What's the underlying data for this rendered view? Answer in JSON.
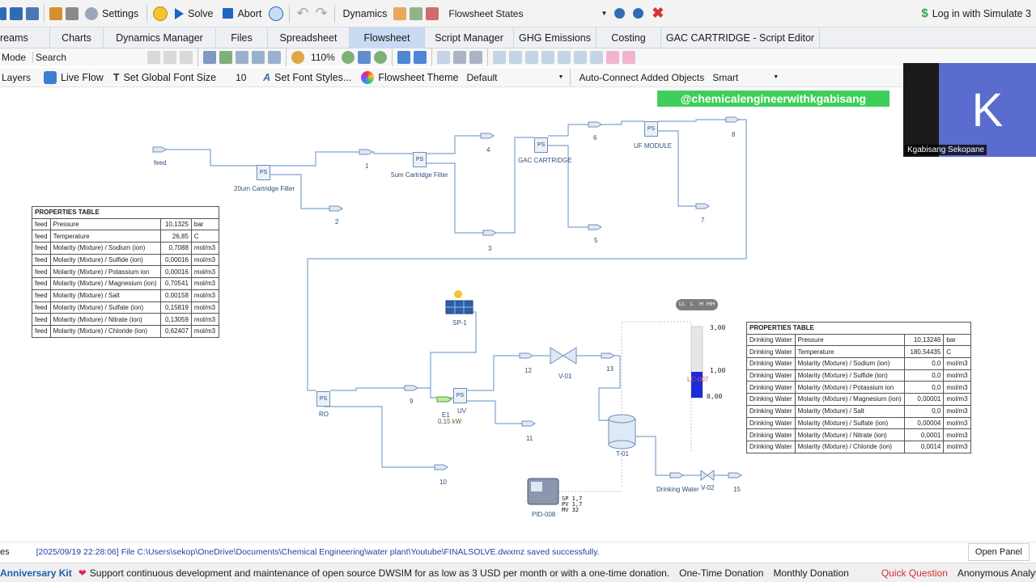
{
  "toolbar": {
    "settings": "Settings",
    "solve": "Solve",
    "abort": "Abort",
    "dynamics": "Dynamics",
    "flowsheet_states": "Flowsheet States",
    "login": "Log in with Simulate 3"
  },
  "tabs": [
    "reams",
    "Charts",
    "Dynamics Manager",
    "Files",
    "Spreadsheet",
    "Flowsheet",
    "Script Manager",
    "GHG Emissions",
    "Costing",
    "GAC CARTRIDGE - Script Editor"
  ],
  "active_tab": "Flowsheet",
  "toolbar2": {
    "mode": "Mode",
    "search": "Search",
    "zoom": "110%"
  },
  "toolbar3": {
    "layers": "Layers",
    "live_flow": "Live Flow",
    "global_font": "Set Global Font Size",
    "font_size": "10",
    "font_styles": "Set Font Styles...",
    "theme_label": "Flowsheet Theme",
    "theme_value": "Default",
    "autoconnect_label": "Auto-Connect Added Objects",
    "autoconnect_value": "Smart"
  },
  "watermark": "@chemicalengineerwithkgabisang",
  "webcam": {
    "initial": "K",
    "name": "Kgabisang Sekopane"
  },
  "flowsheet": {
    "streams": [
      "feed",
      "1",
      "2",
      "3",
      "4",
      "5",
      "6",
      "7",
      "8",
      "9",
      "10",
      "11",
      "12",
      "13",
      "15",
      "Drinking Water"
    ],
    "units": {
      "cf20": "20um Cartridge Filter",
      "cf5": "5um Cartridge Filter",
      "gac": "GAC CARTRIDGE",
      "uf": "UF MODULE",
      "ro": "RO",
      "uv": "UV",
      "sp1": "SP-1",
      "e1": "E1",
      "e1_power": "0,15 kW",
      "v01": "V-01",
      "v02": "V-02",
      "t01": "T-01",
      "lc": "LC-007",
      "pid": "PID-008"
    },
    "ps_label": "PS",
    "level_scale": [
      "3,00",
      "1,00",
      "0,00"
    ],
    "level_buttons": [
      "LL",
      "L",
      "H",
      "HH"
    ],
    "pid_readout": [
      "SP 1,7",
      "PV 1,7",
      "MV 32"
    ]
  },
  "feed_table": {
    "title": "PROPERTIES TABLE",
    "rows": [
      [
        "feed",
        "Pressure",
        "10,1325",
        "bar"
      ],
      [
        "feed",
        "Temperature",
        "26,85",
        "C"
      ],
      [
        "feed",
        "Molarity (Mixture) / Sodium (ion)",
        "0,7088",
        "mol/m3"
      ],
      [
        "feed",
        "Molarity (Mixture) / Sulfide (ion)",
        "0,00016",
        "mol/m3"
      ],
      [
        "feed",
        "Molarity (Mixture) / Potassium ion",
        "0,00016",
        "mol/m3"
      ],
      [
        "feed",
        "Molarity (Mixture) / Magnesium (ion)",
        "0,70541",
        "mol/m3"
      ],
      [
        "feed",
        "Molarity (Mixture) / Salt",
        "0,00158",
        "mol/m3"
      ],
      [
        "feed",
        "Molarity (Mixture) / Sulfate (ion)",
        "0,15819",
        "mol/m3"
      ],
      [
        "feed",
        "Molarity (Mixture) / Nitrate (ion)",
        "0,13059",
        "mol/m3"
      ],
      [
        "feed",
        "Molarity (Mixture) / Chloride (ion)",
        "0,62407",
        "mol/m3"
      ]
    ]
  },
  "dw_table": {
    "title": "PROPERTIES TABLE",
    "rows": [
      [
        "Drinking Water",
        "Pressure",
        "10,13246",
        "bar"
      ],
      [
        "Drinking Water",
        "Temperature",
        "180,54435",
        "C"
      ],
      [
        "Drinking Water",
        "Molarity (Mixture) / Sodium (ion)",
        "0,0",
        "mol/m3"
      ],
      [
        "Drinking Water",
        "Molarity (Mixture) / Sulfide (ion)",
        "0,0",
        "mol/m3"
      ],
      [
        "Drinking Water",
        "Molarity (Mixture) / Potassium ion",
        "0,0",
        "mol/m3"
      ],
      [
        "Drinking Water",
        "Molarity (Mixture) / Magnesium (ion)",
        "0,00001",
        "mol/m3"
      ],
      [
        "Drinking Water",
        "Molarity (Mixture) / Salt",
        "0,0",
        "mol/m3"
      ],
      [
        "Drinking Water",
        "Molarity (Mixture) / Sulfate (ion)",
        "0,00004",
        "mol/m3"
      ],
      [
        "Drinking Water",
        "Molarity (Mixture) / Nitrate (ion)",
        "0,0001",
        "mol/m3"
      ],
      [
        "Drinking Water",
        "Molarity (Mixture) / Chloride (ion)",
        "0,0014",
        "mol/m3"
      ]
    ]
  },
  "log": {
    "prefix": "es",
    "message": "[2025/09/19 22:28:06] File C:\\Users\\sekop\\OneDrive\\Documents\\Chemical Engineering\\water plant\\Youtube\\FINALSOLVE.dwxmz saved successfully.",
    "open_panel": "Open Panel"
  },
  "status": {
    "kit": "Anniversary Kit",
    "support": "Support continuous development and maintenance of open source DWSIM for as low as 3 USD per month or with a one-time donation.",
    "one_time": "One-Time Donation",
    "monthly": "Monthly Donation",
    "quick_question": "Quick Question",
    "analytics": "Anonymous Analytics Sha"
  }
}
